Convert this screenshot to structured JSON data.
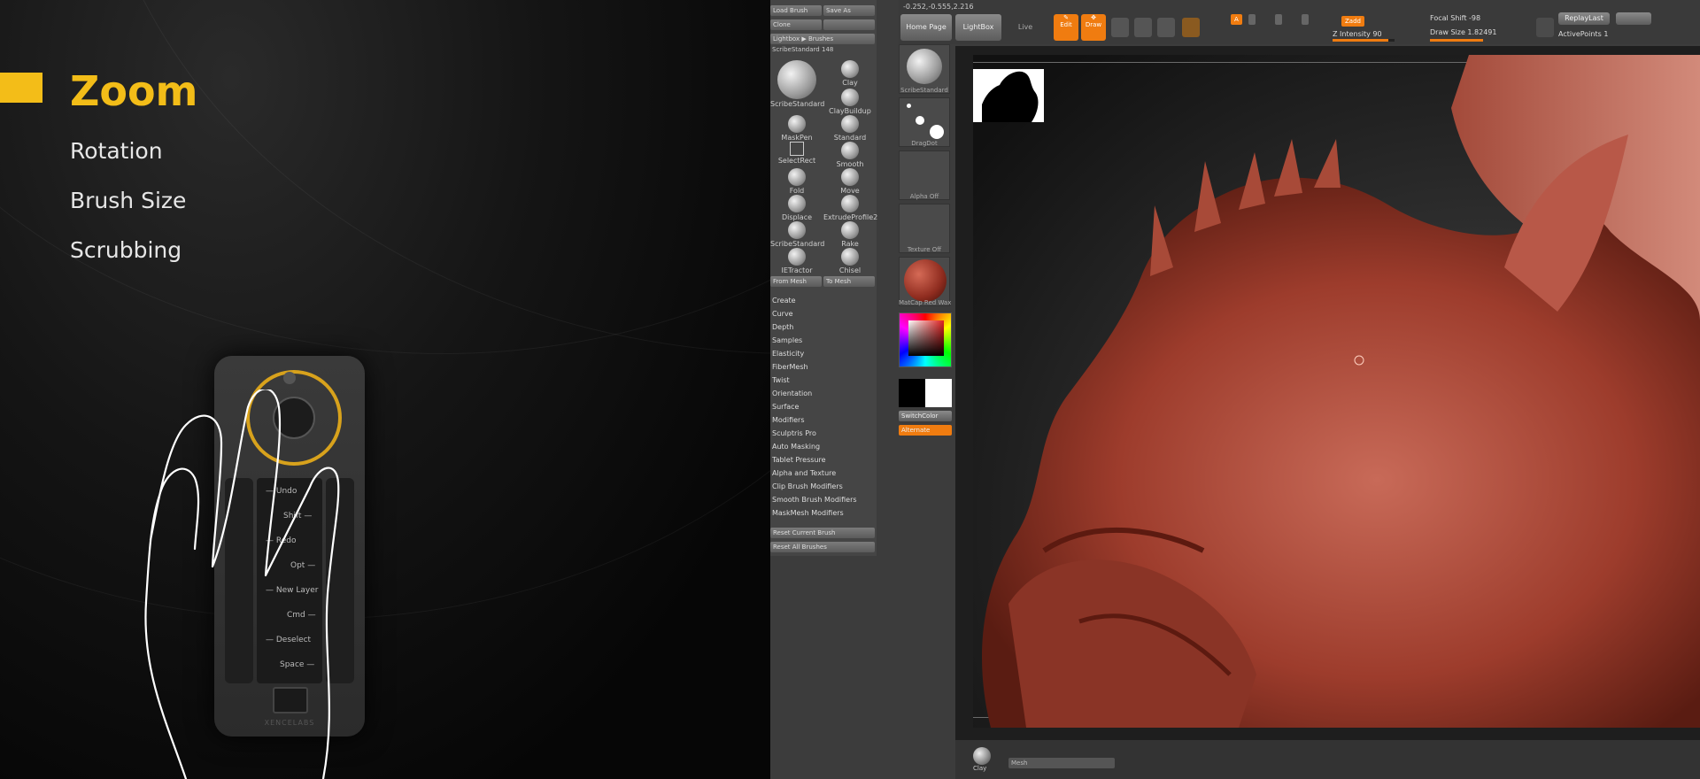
{
  "promo": {
    "active_item": "Zoom",
    "items": [
      "Rotation",
      "Brush Size",
      "Scrubbing"
    ],
    "accent_color": "#f3bd18"
  },
  "device": {
    "keys": [
      {
        "label": "Undo",
        "side": "left"
      },
      {
        "label": "Shift",
        "side": "right"
      },
      {
        "label": "Redo",
        "side": "left"
      },
      {
        "label": "Opt",
        "side": "right"
      },
      {
        "label": "New Layer",
        "side": "left"
      },
      {
        "label": "Cmd",
        "side": "right"
      },
      {
        "label": "Deselect",
        "side": "left"
      },
      {
        "label": "Space",
        "side": "right"
      }
    ],
    "brand": "XENCELABS"
  },
  "zbrush": {
    "top_buttons": [
      "Load Brush",
      "Save As",
      "Clone",
      "Lightbox ▶ Brushes"
    ],
    "brush_selector": "ScribeStandard",
    "brush_count": "148",
    "brushes": [
      {
        "name": "ScribeStandard",
        "large": true
      },
      {
        "name": "Clay"
      },
      {
        "name": "ClayBuildup"
      },
      {
        "name": "MaskPen"
      },
      {
        "name": "Standard"
      },
      {
        "name": "SelectRect"
      },
      {
        "name": "Smooth"
      },
      {
        "name": "Fold"
      },
      {
        "name": "Move"
      },
      {
        "name": "Displace"
      },
      {
        "name": "ExtrudeProfile2"
      },
      {
        "name": "ScribeStandard"
      },
      {
        "name": "Rake"
      },
      {
        "name": "IETractor"
      },
      {
        "name": "Chisel"
      }
    ],
    "brush_bottom_buttons": [
      "From Mesh",
      "To Mesh"
    ],
    "sub_menus": [
      "Create",
      "Curve",
      "Depth",
      "Samples",
      "Elasticity",
      "FiberMesh",
      "Twist",
      "Orientation",
      "Surface",
      "Modifiers",
      "Sculptris Pro",
      "Auto Masking",
      "Tablet Pressure",
      "Alpha and Texture",
      "Clip Brush Modifiers",
      "Smooth Brush Modifiers",
      "MaskMesh Modifiers"
    ],
    "reset_buttons": [
      "Reset Current Brush",
      "Reset All Brushes"
    ],
    "mid_tiles": [
      {
        "label": "ScribeStandard"
      },
      {
        "label": "DragDot"
      },
      {
        "label": "Alpha Off"
      },
      {
        "label": "Texture Off"
      },
      {
        "label": "MatCap Red Wax"
      }
    ],
    "switch_color_label": "SwitchColor",
    "alternate_label": "Alternate",
    "coords": "-0.252,-0.555,2.216",
    "home_page": "Home Page",
    "lightbox": "LightBox",
    "live_boolean": "Live Boolean",
    "edit_label": "Edit",
    "draw_label": "Draw",
    "draw_size_label": "Draw Size",
    "draw_size_value": "1.82491",
    "focal_shift_label": "Focal Shift",
    "focal_shift_value": "-98",
    "z_intensity_label": "Z Intensity",
    "z_intensity_value": "90",
    "replay_last": "ReplayLast",
    "active_points_label": "ActivePoints",
    "active_points_value": "1",
    "zadd": "Zadd",
    "bottom_brush_label": "Clay",
    "bottom_field": "Mesh",
    "accent_orange": "#f07c10"
  }
}
